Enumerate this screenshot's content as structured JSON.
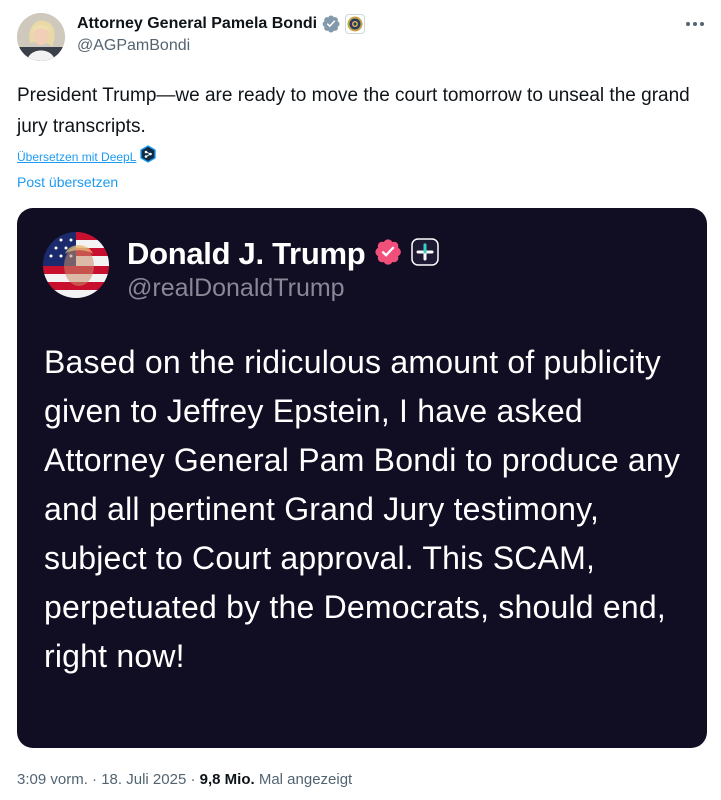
{
  "header": {
    "display_name": "Attorney General Pamela Bondi",
    "handle": "@AGPamBondi",
    "verified_icon": "verified-badge-icon",
    "affiliation_icon": "doj-seal-icon",
    "more_icon": "more-options-icon"
  },
  "tweet": {
    "text": "President Trump—we are ready to move the court tomorrow to unseal the grand jury transcripts.",
    "translate_deepl": "Übersetzen mit DeepL",
    "translate_post": "Post übersetzen"
  },
  "card": {
    "display_name": "Donald J. Trump",
    "handle": "@realDonaldTrump",
    "text": "Based on the ridiculous amount of publicity given to Jeffrey Epstein, I have asked Attorney General Pam Bondi to produce any and all pertinent Grand Jury testimony, subject to Court approval. This SCAM, perpetuated by the Democrats, should end, right now!",
    "background_color": "#110d22",
    "verified_color": "#f0507a"
  },
  "meta": {
    "time": "3:09 vorm.",
    "separator": " · ",
    "date": "18. Juli 2025",
    "views_count": "9,8 Mio.",
    "views_label": "Mal angezeigt"
  },
  "colors": {
    "link_blue": "#1d9bf0",
    "secondary_text": "#536471",
    "verified_blue": "#1d9bf0"
  }
}
